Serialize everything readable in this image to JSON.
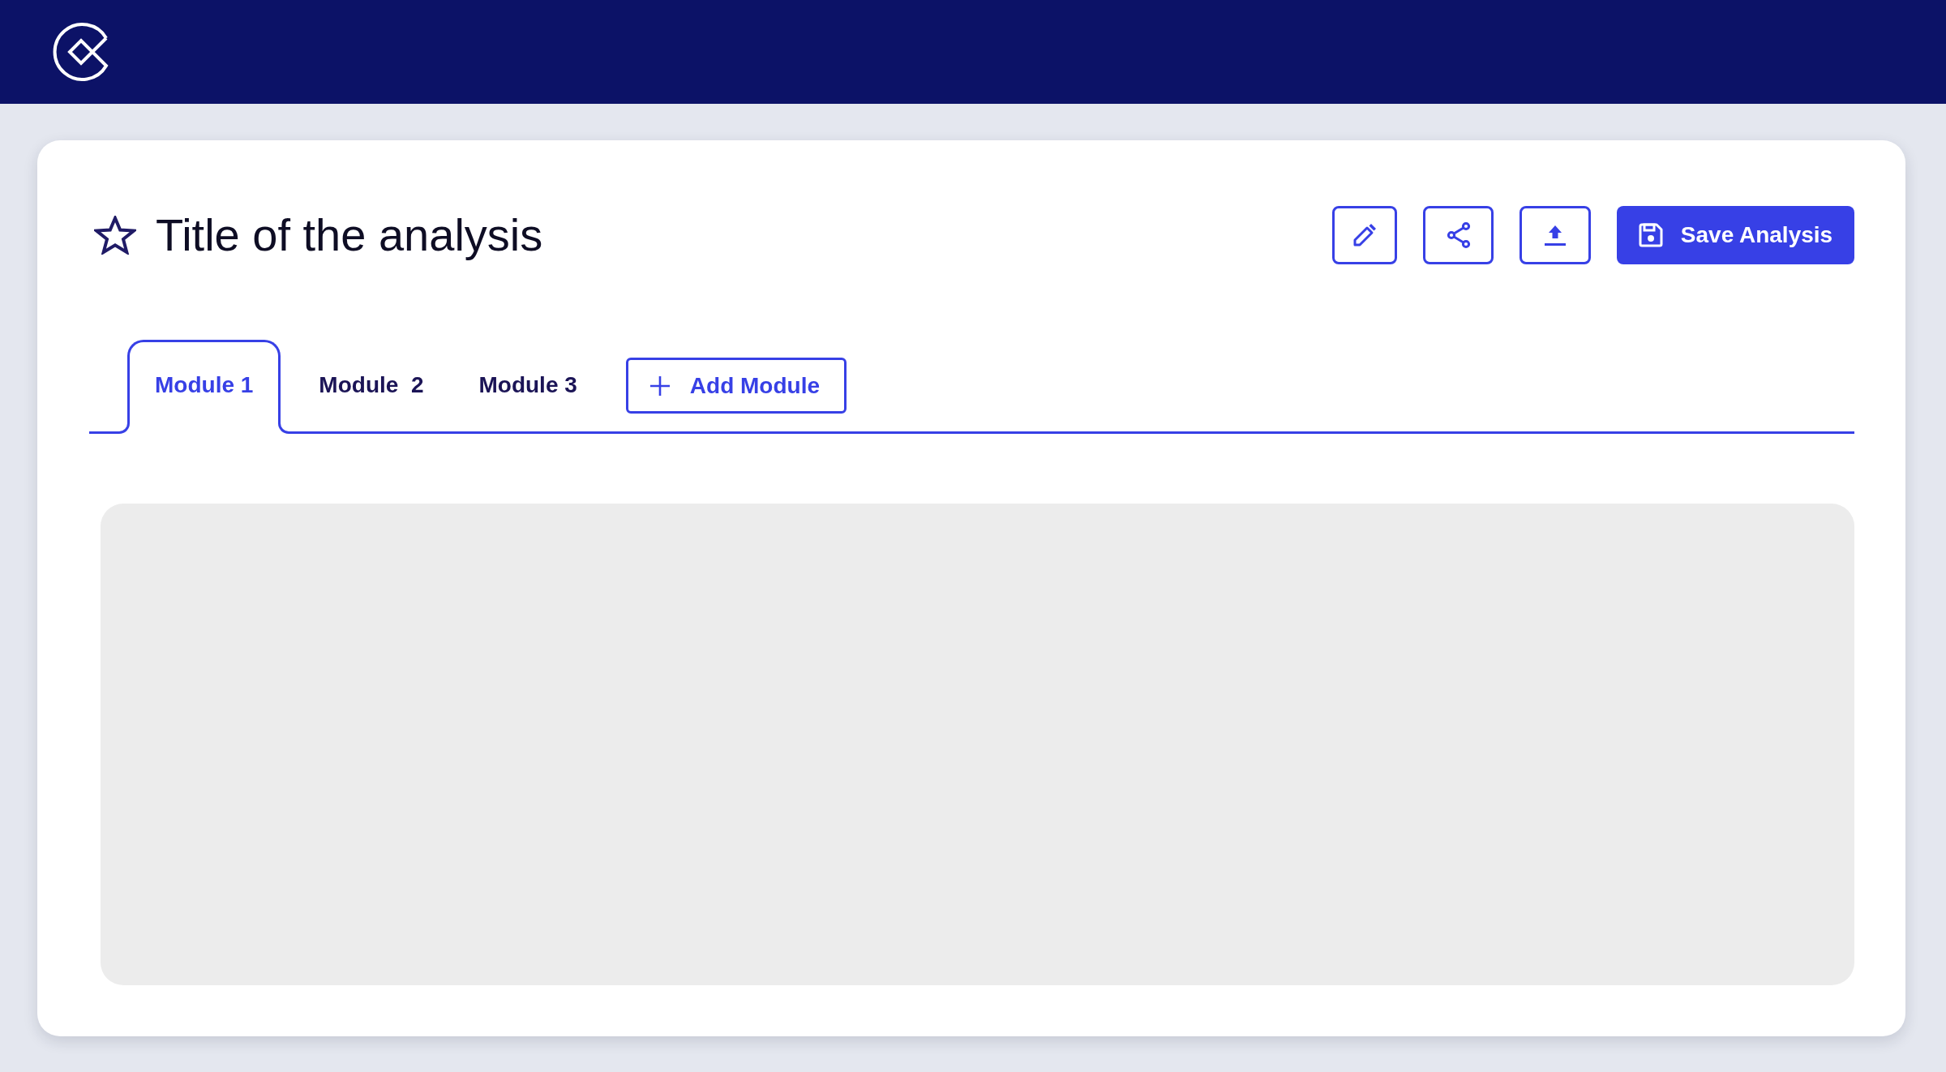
{
  "analysis": {
    "title": "Title of the analysis",
    "favorite": false
  },
  "toolbar": {
    "buttons": [
      {
        "kind": "edit"
      },
      {
        "kind": "share"
      },
      {
        "kind": "upload"
      },
      {
        "kind": "save",
        "label": "Save Analysis"
      }
    ]
  },
  "tabs": [
    {
      "label": "Module 1",
      "selected": true
    },
    {
      "label": "Module  2",
      "selected": false
    },
    {
      "label": "Module 3",
      "selected": false
    }
  ],
  "add_module": {
    "label": "Add Module"
  }
}
